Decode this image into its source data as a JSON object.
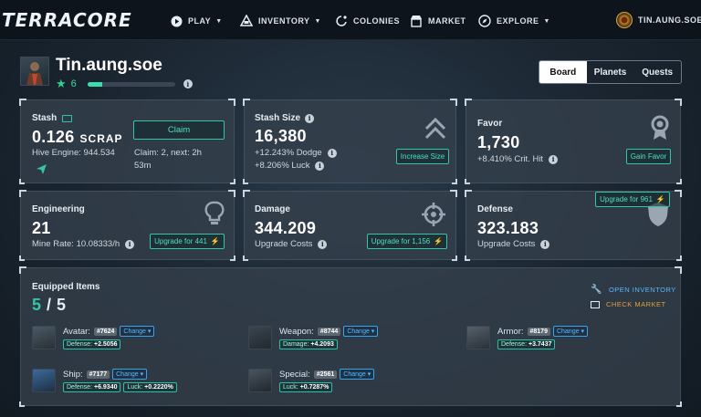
{
  "nav": {
    "logo": "TERRACORE",
    "items": [
      {
        "label": "PLAY",
        "icon": "play-icon",
        "caret": true
      },
      {
        "label": "INVENTORY",
        "icon": "ship-icon",
        "caret": true
      },
      {
        "label": "COLONIES",
        "icon": "planet-icon",
        "caret": false
      },
      {
        "label": "MARKET",
        "icon": "shop-icon",
        "caret": false
      },
      {
        "label": "EXPLORE",
        "icon": "compass-icon",
        "caret": true
      }
    ],
    "user": "TIN.AUNG.SOE"
  },
  "profile": {
    "name": "Tin.aung.soe",
    "level": "6",
    "xp_progress": 0.17
  },
  "tabs": [
    "Board",
    "Planets",
    "Quests"
  ],
  "active_tab": "Board",
  "stash": {
    "title": "Stash",
    "amount": "0.126",
    "unit": "SCRAP",
    "hive": "Hive Engine: 944.534",
    "claim_button": "Claim",
    "claim_info": "Claim: 2, next: 2h",
    "claim_time": "53m"
  },
  "stash_size": {
    "title": "Stash Size",
    "value": "16,380",
    "dodge": "+12.243% Dodge",
    "luck": "+8.206% Luck",
    "button": "Increase Size"
  },
  "favor": {
    "title": "Favor",
    "value": "1,730",
    "crit": "+8.410% Crit. Hit",
    "button": "Gain Favor"
  },
  "engineering": {
    "title": "Engineering",
    "value": "21",
    "rate": "Mine Rate: 10.08333/h",
    "button": "Upgrade for 441"
  },
  "damage": {
    "title": "Damage",
    "value": "344.209",
    "costs": "Upgrade Costs",
    "button": "Upgrade for 1,156"
  },
  "defense": {
    "title": "Defense",
    "value": "323.183",
    "costs": "Upgrade Costs",
    "button": "Upgrade for 961"
  },
  "equipped": {
    "title": "Equipped Items",
    "count": "5",
    "total": "5",
    "open_inventory": "OPEN INVENTORY",
    "check_market": "CHECK MARKET",
    "change_label": "Change",
    "items": [
      {
        "slot": "Avatar:",
        "id": "#7624",
        "stats": [
          {
            "name": "Defense:",
            "value": "+2.5056"
          }
        ]
      },
      {
        "slot": "Weapon:",
        "id": "#8744",
        "stats": [
          {
            "name": "Damage:",
            "value": "+4.2093"
          }
        ]
      },
      {
        "slot": "Armor:",
        "id": "#8179",
        "stats": [
          {
            "name": "Defense:",
            "value": "+3.7437"
          }
        ]
      },
      {
        "slot": "Ship:",
        "id": "#7177",
        "stats": [
          {
            "name": "Defense:",
            "value": "+6.9340"
          },
          {
            "name": "Luck:",
            "value": "+0.2220%"
          }
        ]
      },
      {
        "slot": "Special:",
        "id": "#2561",
        "stats": [
          {
            "name": "Luck:",
            "value": "+0.7287%"
          }
        ]
      }
    ]
  },
  "colors": {
    "accent_teal": "#35c4a8",
    "accent_blue": "#59b8ff",
    "market_orange": "#e0a040",
    "level_green": "#3ddc9a"
  }
}
